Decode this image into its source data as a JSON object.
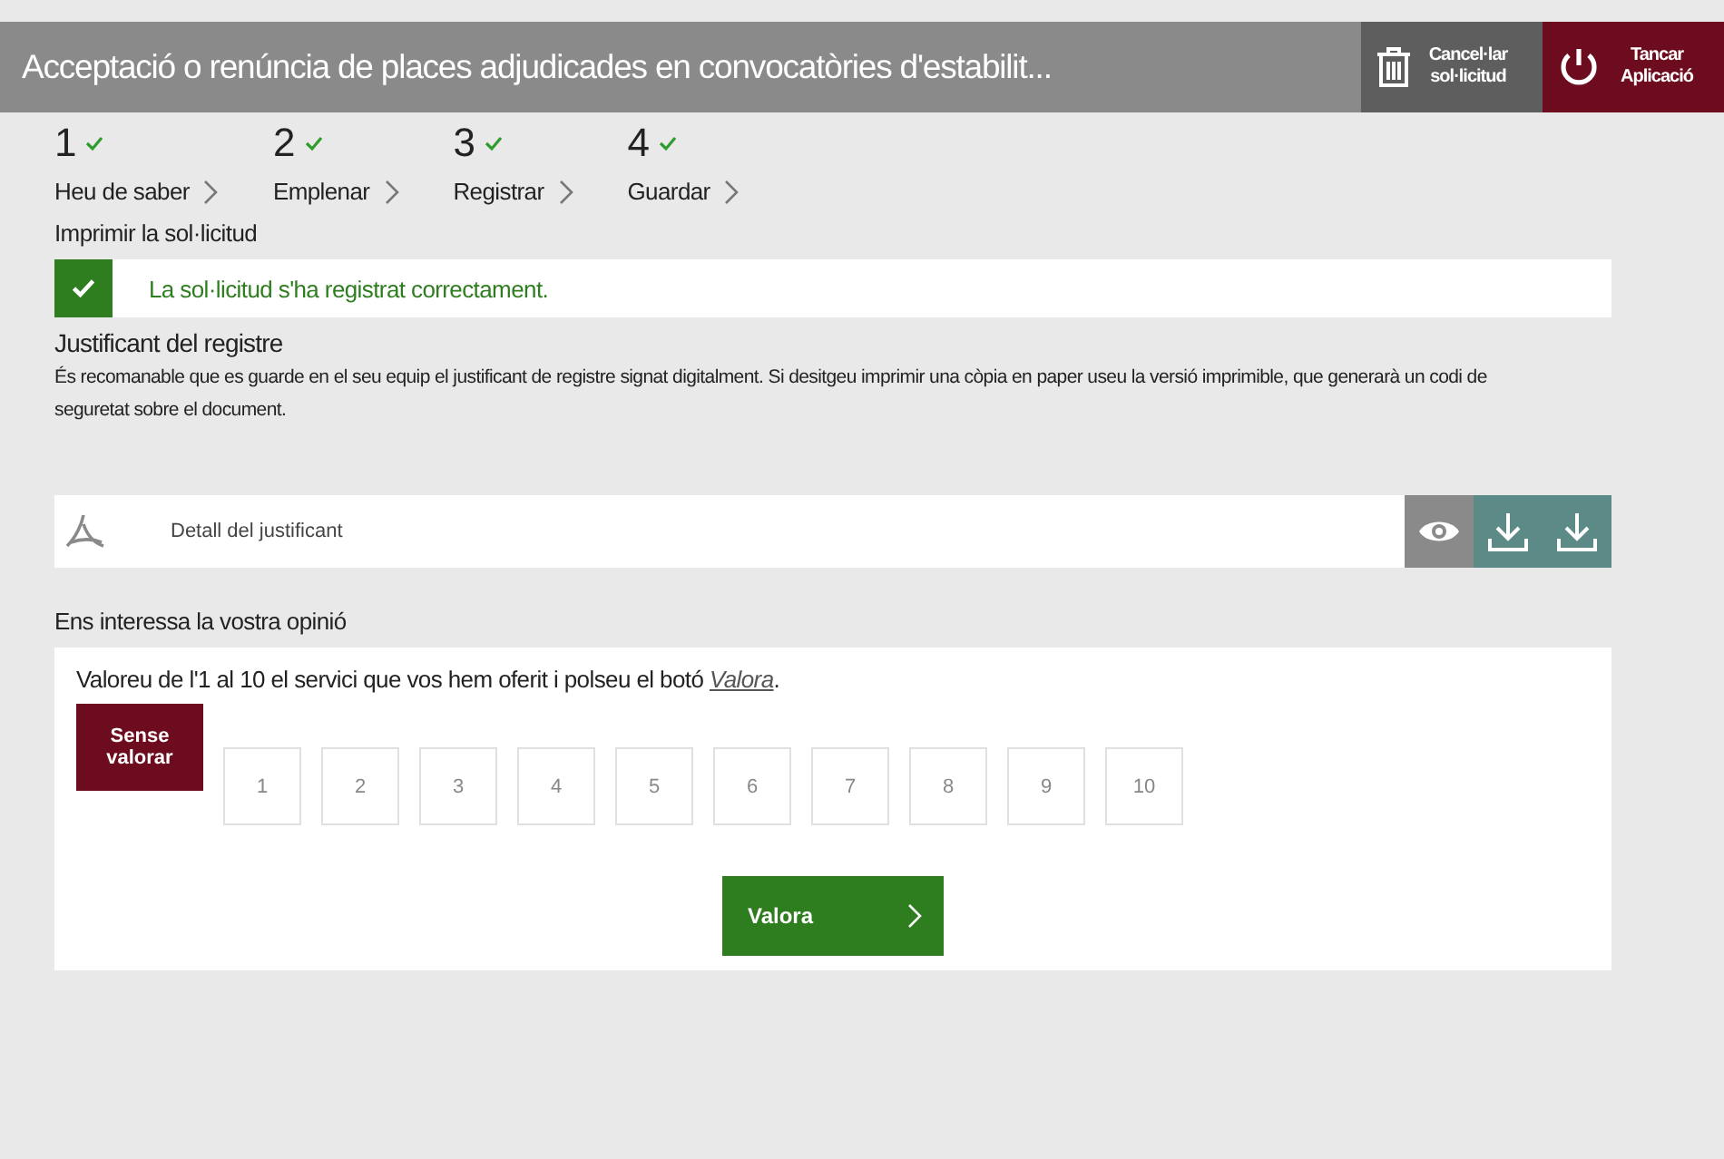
{
  "header": {
    "title": "Acceptació o renúncia de places adjudicades en convocatòries d'estabilit...",
    "cancel": "Cancel·lar sol·licitud",
    "close": "Tancar Aplicació"
  },
  "steps": [
    {
      "number": "1",
      "label": "Heu de saber",
      "done": true
    },
    {
      "number": "2",
      "label": "Emplenar",
      "done": true
    },
    {
      "number": "3",
      "label": "Registrar",
      "done": true
    },
    {
      "number": "4",
      "label": "Guardar",
      "done": true
    }
  ],
  "section_title": "Imprimir la sol·licitud",
  "alert": {
    "text": "La sol·licitud s'ha registrat correctament."
  },
  "receipt": {
    "title": "Justificant del registre",
    "description": "És recomanable que es guarde en el seu equip el justificant de registre signat digitalment. Si desitgeu imprimir una còpia en paper useu la versió imprimible, que generarà un codi de seguretat sobre el document.",
    "file": "Detall del justificant"
  },
  "feedback": {
    "title": "Ens interessa la vostra opinió",
    "prompt": "Valoreu de l'1 al 10 el servici que vos hem oferit i polseu el botó",
    "link": "Valora",
    "suffix": ".",
    "options": [
      {
        "label": "Sense valorar",
        "selected": true
      },
      {
        "label": "1",
        "selected": false
      },
      {
        "label": "2",
        "selected": false
      },
      {
        "label": "3",
        "selected": false
      },
      {
        "label": "4",
        "selected": false
      },
      {
        "label": "5",
        "selected": false
      },
      {
        "label": "6",
        "selected": false
      },
      {
        "label": "7",
        "selected": false
      },
      {
        "label": "8",
        "selected": false
      },
      {
        "label": "9",
        "selected": false
      },
      {
        "label": "10",
        "selected": false
      }
    ],
    "submit": "Valora"
  }
}
